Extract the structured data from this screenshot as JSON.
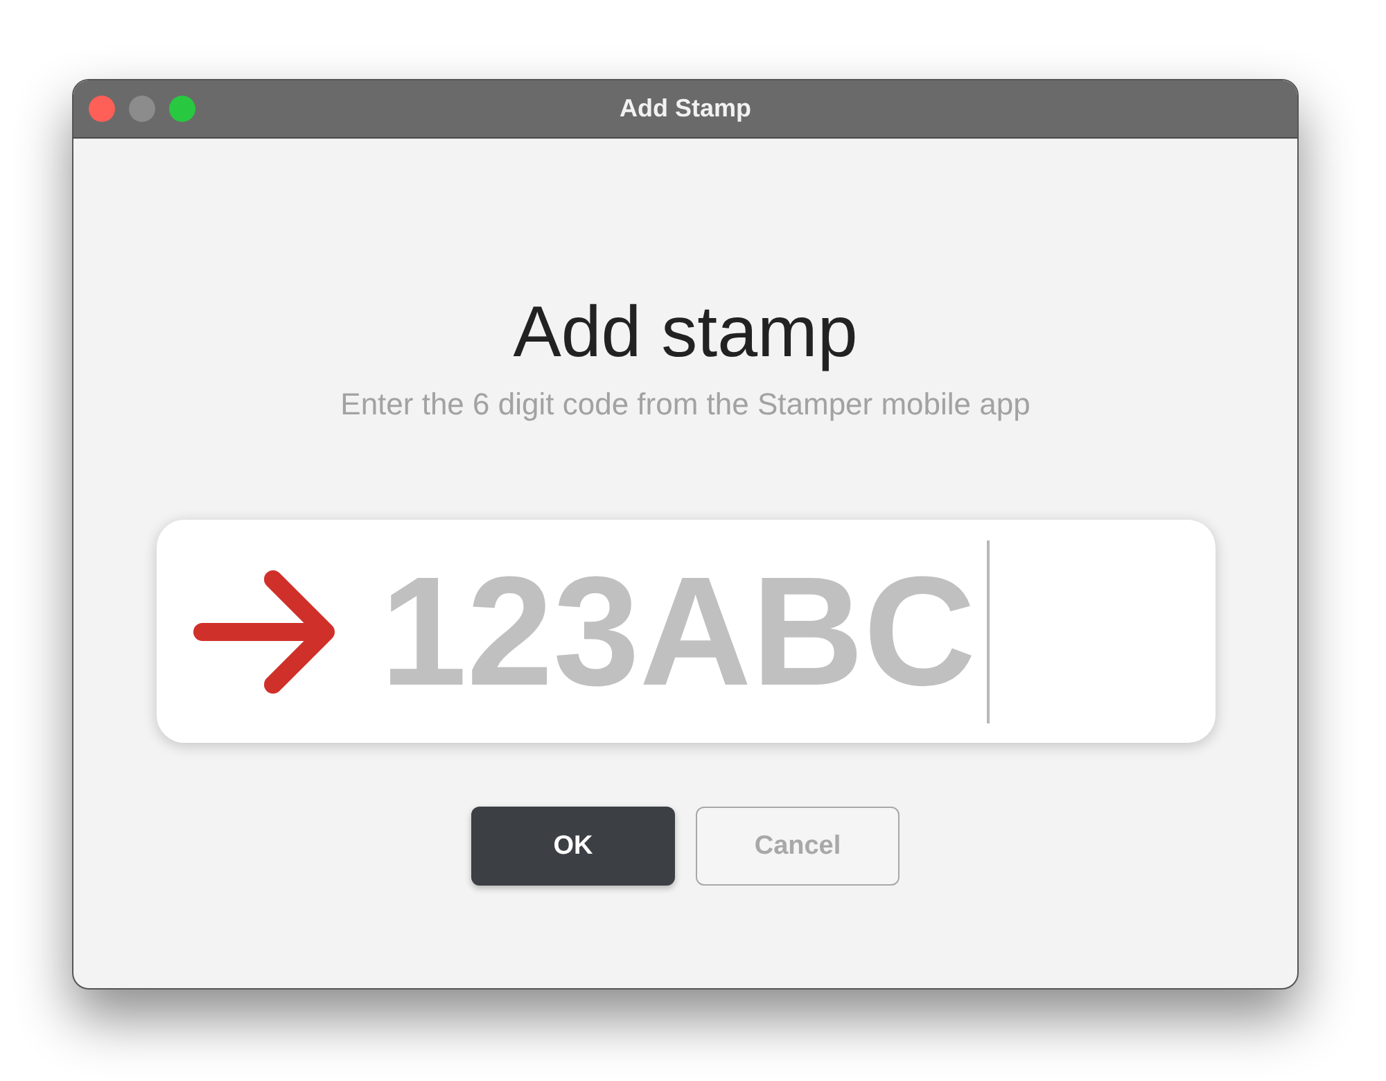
{
  "window": {
    "title": "Add Stamp",
    "controls": [
      {
        "color": "#fe5f57"
      },
      {
        "color": "#8c8c8c"
      },
      {
        "color": "#28c840"
      }
    ]
  },
  "heading": "Add stamp",
  "subtitle": "Enter the 6 digit code from the Stamper mobile app",
  "code_field": {
    "placeholder": "123ABC"
  },
  "buttons": [
    {
      "label": "OK",
      "kind": "primary"
    },
    {
      "label": "Cancel",
      "kind": "secondary"
    }
  ]
}
